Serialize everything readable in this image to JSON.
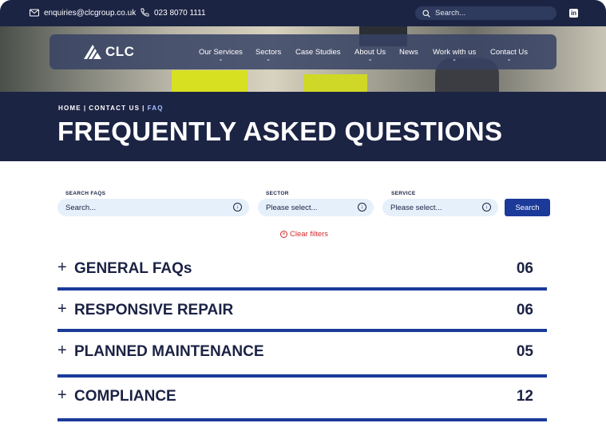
{
  "topbar": {
    "email": "enquiries@clcgroup.co.uk",
    "phone": "023 8070 1111",
    "search_placeholder": "Search...",
    "linkedin_label": "in"
  },
  "nav": {
    "logo_text": "CLC",
    "items": [
      {
        "label": "Our Services",
        "has_dropdown": true
      },
      {
        "label": "Sectors",
        "has_dropdown": true
      },
      {
        "label": "Case Studies",
        "has_dropdown": false
      },
      {
        "label": "About Us",
        "has_dropdown": true
      },
      {
        "label": "News",
        "has_dropdown": false
      },
      {
        "label": "Work with us",
        "has_dropdown": true
      },
      {
        "label": "Contact Us",
        "has_dropdown": true
      }
    ]
  },
  "breadcrumb": [
    "HOME",
    "CONTACT US",
    "FAQ"
  ],
  "page_title": "FREQUENTLY ASKED QUESTIONS",
  "filters": {
    "search_label": "SEARCH FAQS",
    "search_placeholder": "Search...",
    "sector_label": "SECTOR",
    "sector_value": "Please select...",
    "service_label": "SERVICE",
    "service_value": "Please select...",
    "search_button": "Search",
    "clear_label": "Clear filters"
  },
  "faq_sections": [
    {
      "title": "GENERAL FAQs",
      "count": "06"
    },
    {
      "title": "RESPONSIVE REPAIR",
      "count": "06"
    },
    {
      "title": "PLANNED MAINTENANCE",
      "count": "05"
    },
    {
      "title": "COMPLIANCE",
      "count": "12"
    }
  ],
  "colors": {
    "navy": "#1c2444",
    "accent_blue": "#1b3a99",
    "field_bg": "#e6f0fa",
    "clear_red": "#d12a2a"
  }
}
